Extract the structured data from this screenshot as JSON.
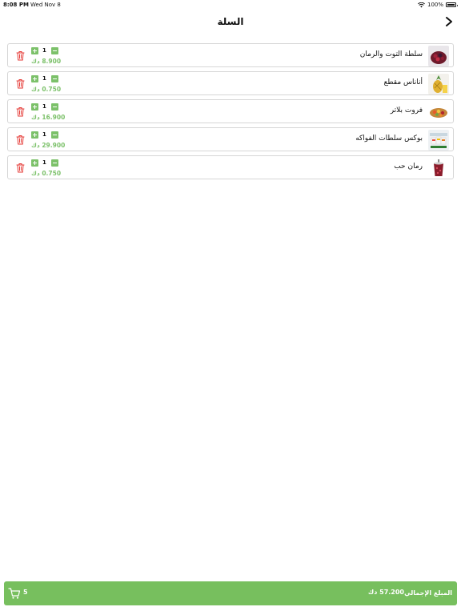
{
  "status_bar": {
    "time": "8:08 PM",
    "date": "Wed Nov 8",
    "battery": "100%"
  },
  "nav": {
    "title": "السلة"
  },
  "cart": {
    "items": [
      {
        "name": "سلطة التوت والرمان",
        "qty": "1",
        "price": "8.900 دك"
      },
      {
        "name": "أناناس مقطع",
        "qty": "1",
        "price": "0.750 دك"
      },
      {
        "name": "فروت بلاتر",
        "qty": "1",
        "price": "16.900 دك"
      },
      {
        "name": "بوكس سلطات الفواكه",
        "qty": "1",
        "price": "29.900 دك"
      },
      {
        "name": "رمان حب",
        "qty": "1",
        "price": "0.750 دك"
      }
    ]
  },
  "footer": {
    "total_label": "المبلغ الإجمالي",
    "total_value": "57.200 دك",
    "item_count": "5"
  },
  "colors": {
    "accent": "#77bf5e",
    "delete": "#e53935"
  }
}
